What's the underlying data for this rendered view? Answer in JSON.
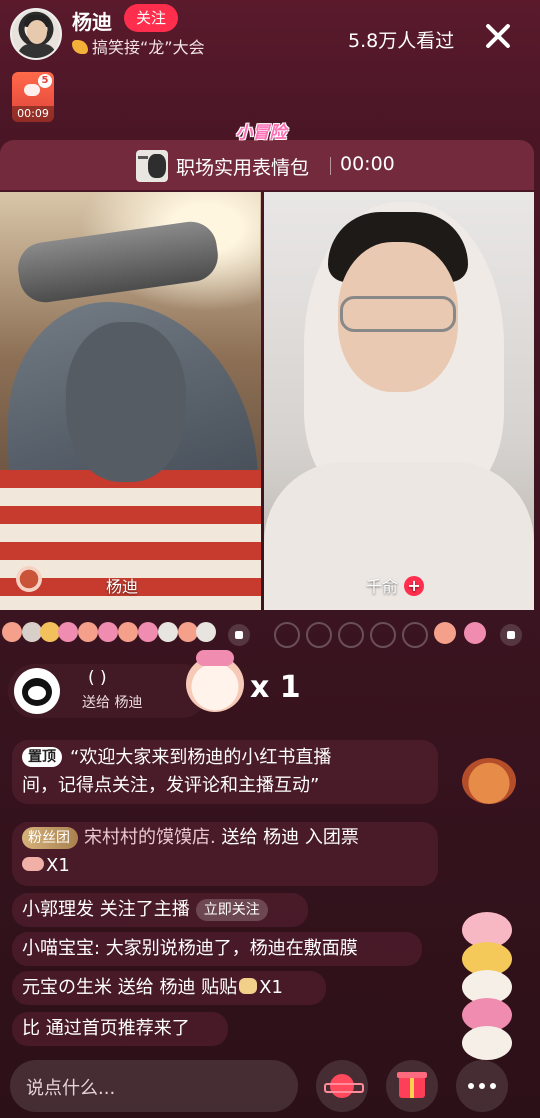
{
  "header": {
    "host_name": "杨迪",
    "follow_label": "关注",
    "host_subtitle": "搞笑接“龙”大会",
    "viewers": "5.8万人看过",
    "close_icon": "close-icon"
  },
  "mini_card": {
    "badge": "5",
    "time": "00:09"
  },
  "game_logo": "小冒险",
  "topic": {
    "title": "职场实用表情包",
    "time": "00:00"
  },
  "panes": {
    "left_name": "杨迪",
    "right_name": "千俞",
    "right_add": "+"
  },
  "gift": {
    "sender": "( )",
    "sub": "送给 杨迪",
    "multiplier": "x 1"
  },
  "chat": {
    "pinned_tag": "置顶",
    "pinned_line1": "“欢迎大家来到杨迪的小红书直播",
    "pinned_line2": "间，记得点关注，发评论和主播互动”",
    "fan_tag": "粉丝团",
    "fan_line1_dim": "宋村村的馍馍店.",
    "fan_line1": " 送给 杨迪 入团票",
    "fan_line2": "X1",
    "follow_user": "小郭理发",
    "follow_text": " 关注了主播",
    "follow_btn": "立即关注",
    "msg1_user": "小喵宝宝:",
    "msg1_text": " 大家别说杨迪了，杨迪在敷面膜",
    "msg2_user": "元宝の生米",
    "msg2_text": " 送给 杨迪 贴贴",
    "msg2_count": "X1",
    "msg3_user": "比",
    "msg3_text": " 通过首页推荐来了"
  },
  "bottom": {
    "input_placeholder": "说点什么..."
  },
  "colors": {
    "accent": "#ff2e4d",
    "background": "#3a1420"
  }
}
